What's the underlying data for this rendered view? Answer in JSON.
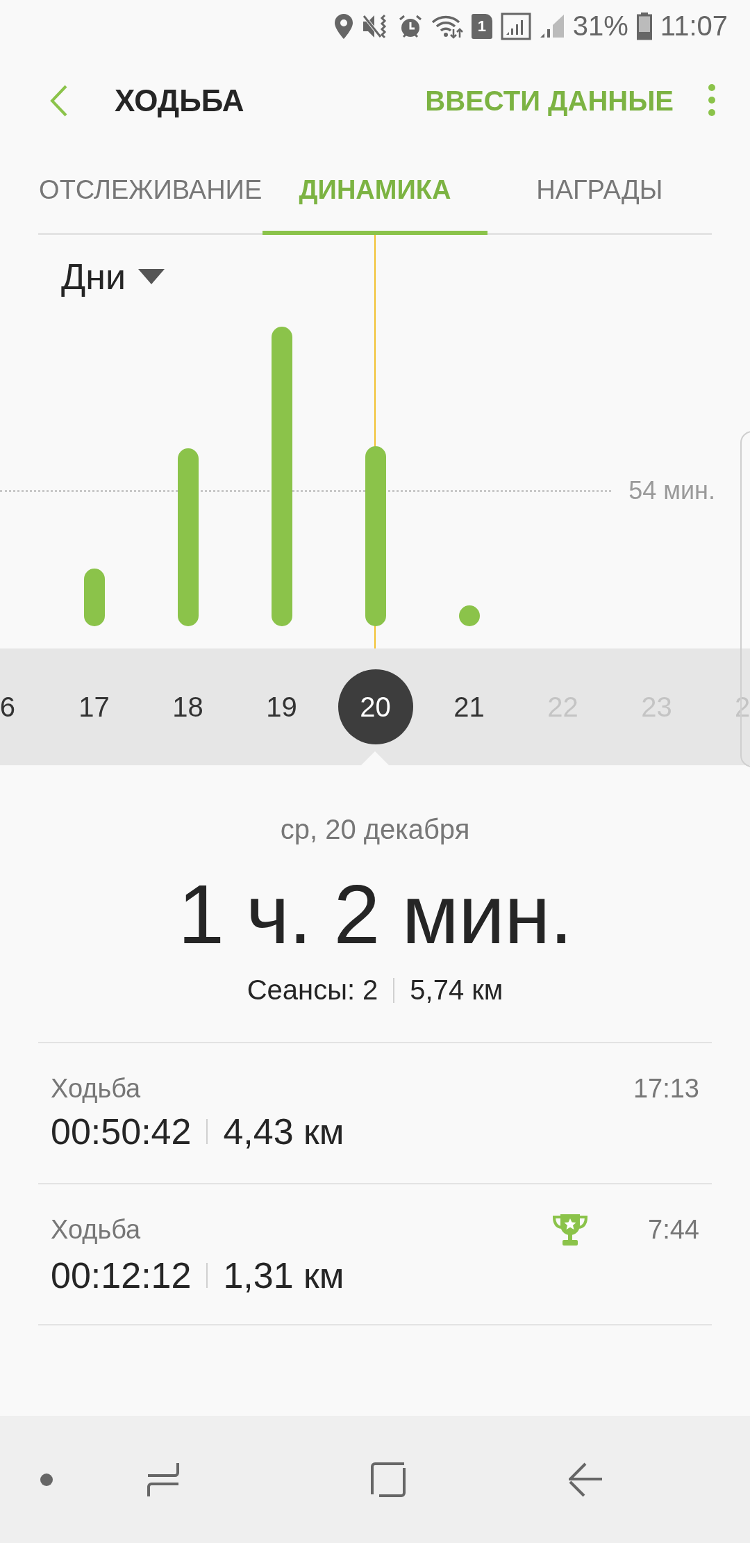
{
  "status_bar": {
    "sim": "1",
    "battery": "31%",
    "time": "11:07"
  },
  "header": {
    "title": "ХОДЬБА",
    "action": "ВВЕСТИ ДАННЫЕ"
  },
  "tabs": [
    {
      "label": "ОТСЛЕЖИВАНИЕ",
      "selected": false
    },
    {
      "label": "ДИНАМИКА",
      "selected": true
    },
    {
      "label": "НАГРАДЫ",
      "selected": false
    }
  ],
  "chart": {
    "period": "Дни",
    "reference_label": "54 мин."
  },
  "days": [
    {
      "label": "6",
      "selected": false,
      "disabled": false
    },
    {
      "label": "17",
      "selected": false,
      "disabled": false
    },
    {
      "label": "18",
      "selected": false,
      "disabled": false
    },
    {
      "label": "19",
      "selected": false,
      "disabled": false
    },
    {
      "label": "20",
      "selected": true,
      "disabled": false
    },
    {
      "label": "21",
      "selected": false,
      "disabled": false
    },
    {
      "label": "22",
      "selected": false,
      "disabled": true
    },
    {
      "label": "23",
      "selected": false,
      "disabled": true
    },
    {
      "label": "2",
      "selected": false,
      "disabled": true
    }
  ],
  "summary": {
    "date": "ср, 20 декабря",
    "total": "1 ч. 2 мин.",
    "sessions": "Сеансы: 2",
    "distance": "5,74 км"
  },
  "sessions": [
    {
      "name": "Ходьба",
      "time": "17:13",
      "duration": "00:50:42",
      "distance": "4,43 км",
      "award": false
    },
    {
      "name": "Ходьба",
      "time": "7:44",
      "duration": "00:12:12",
      "distance": "1,31 км",
      "award": true
    }
  ]
}
